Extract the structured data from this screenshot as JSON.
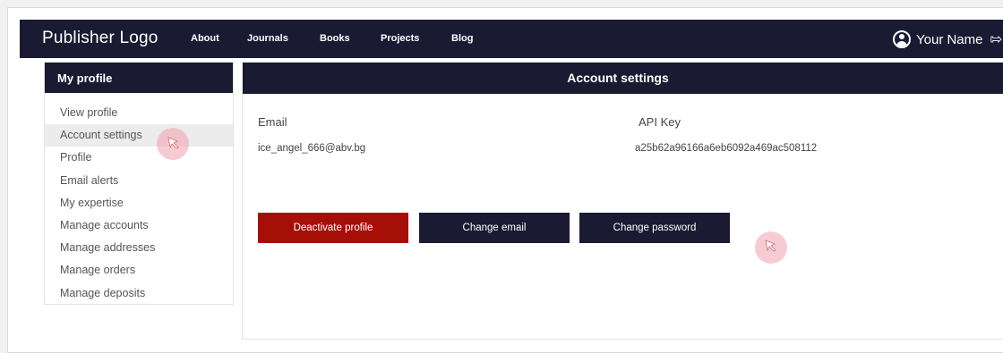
{
  "navbar": {
    "logo": "Publisher Logo",
    "links": [
      "About",
      "Journals",
      "Books",
      "Projects",
      "Blog"
    ],
    "user_name": "Your Name",
    "user_icon": "user-circle-icon",
    "logout_icon": "logout-icon"
  },
  "sidebar": {
    "title": "My profile",
    "items": [
      "View profile",
      "Account settings",
      "Profile",
      "Email alerts",
      "My expertise",
      "Manage accounts",
      "Manage addresses",
      "Manage orders",
      "Manage deposits"
    ],
    "active_index": 1
  },
  "main": {
    "title": "Account settings",
    "email_label": "Email",
    "email_value": "ice_angel_666@abv.bg",
    "api_key_label": "API Key",
    "api_key_value": "a25b62a96166a6eb6092a469ac508112",
    "buttons": {
      "deactivate": "Deactivate profile",
      "change_email": "Change email",
      "change_password": "Change password"
    }
  },
  "colors": {
    "navy": "#1a1a33",
    "danger": "#a60f07",
    "active_bg": "#ececec",
    "cursor_highlight": "#f0a0af"
  }
}
